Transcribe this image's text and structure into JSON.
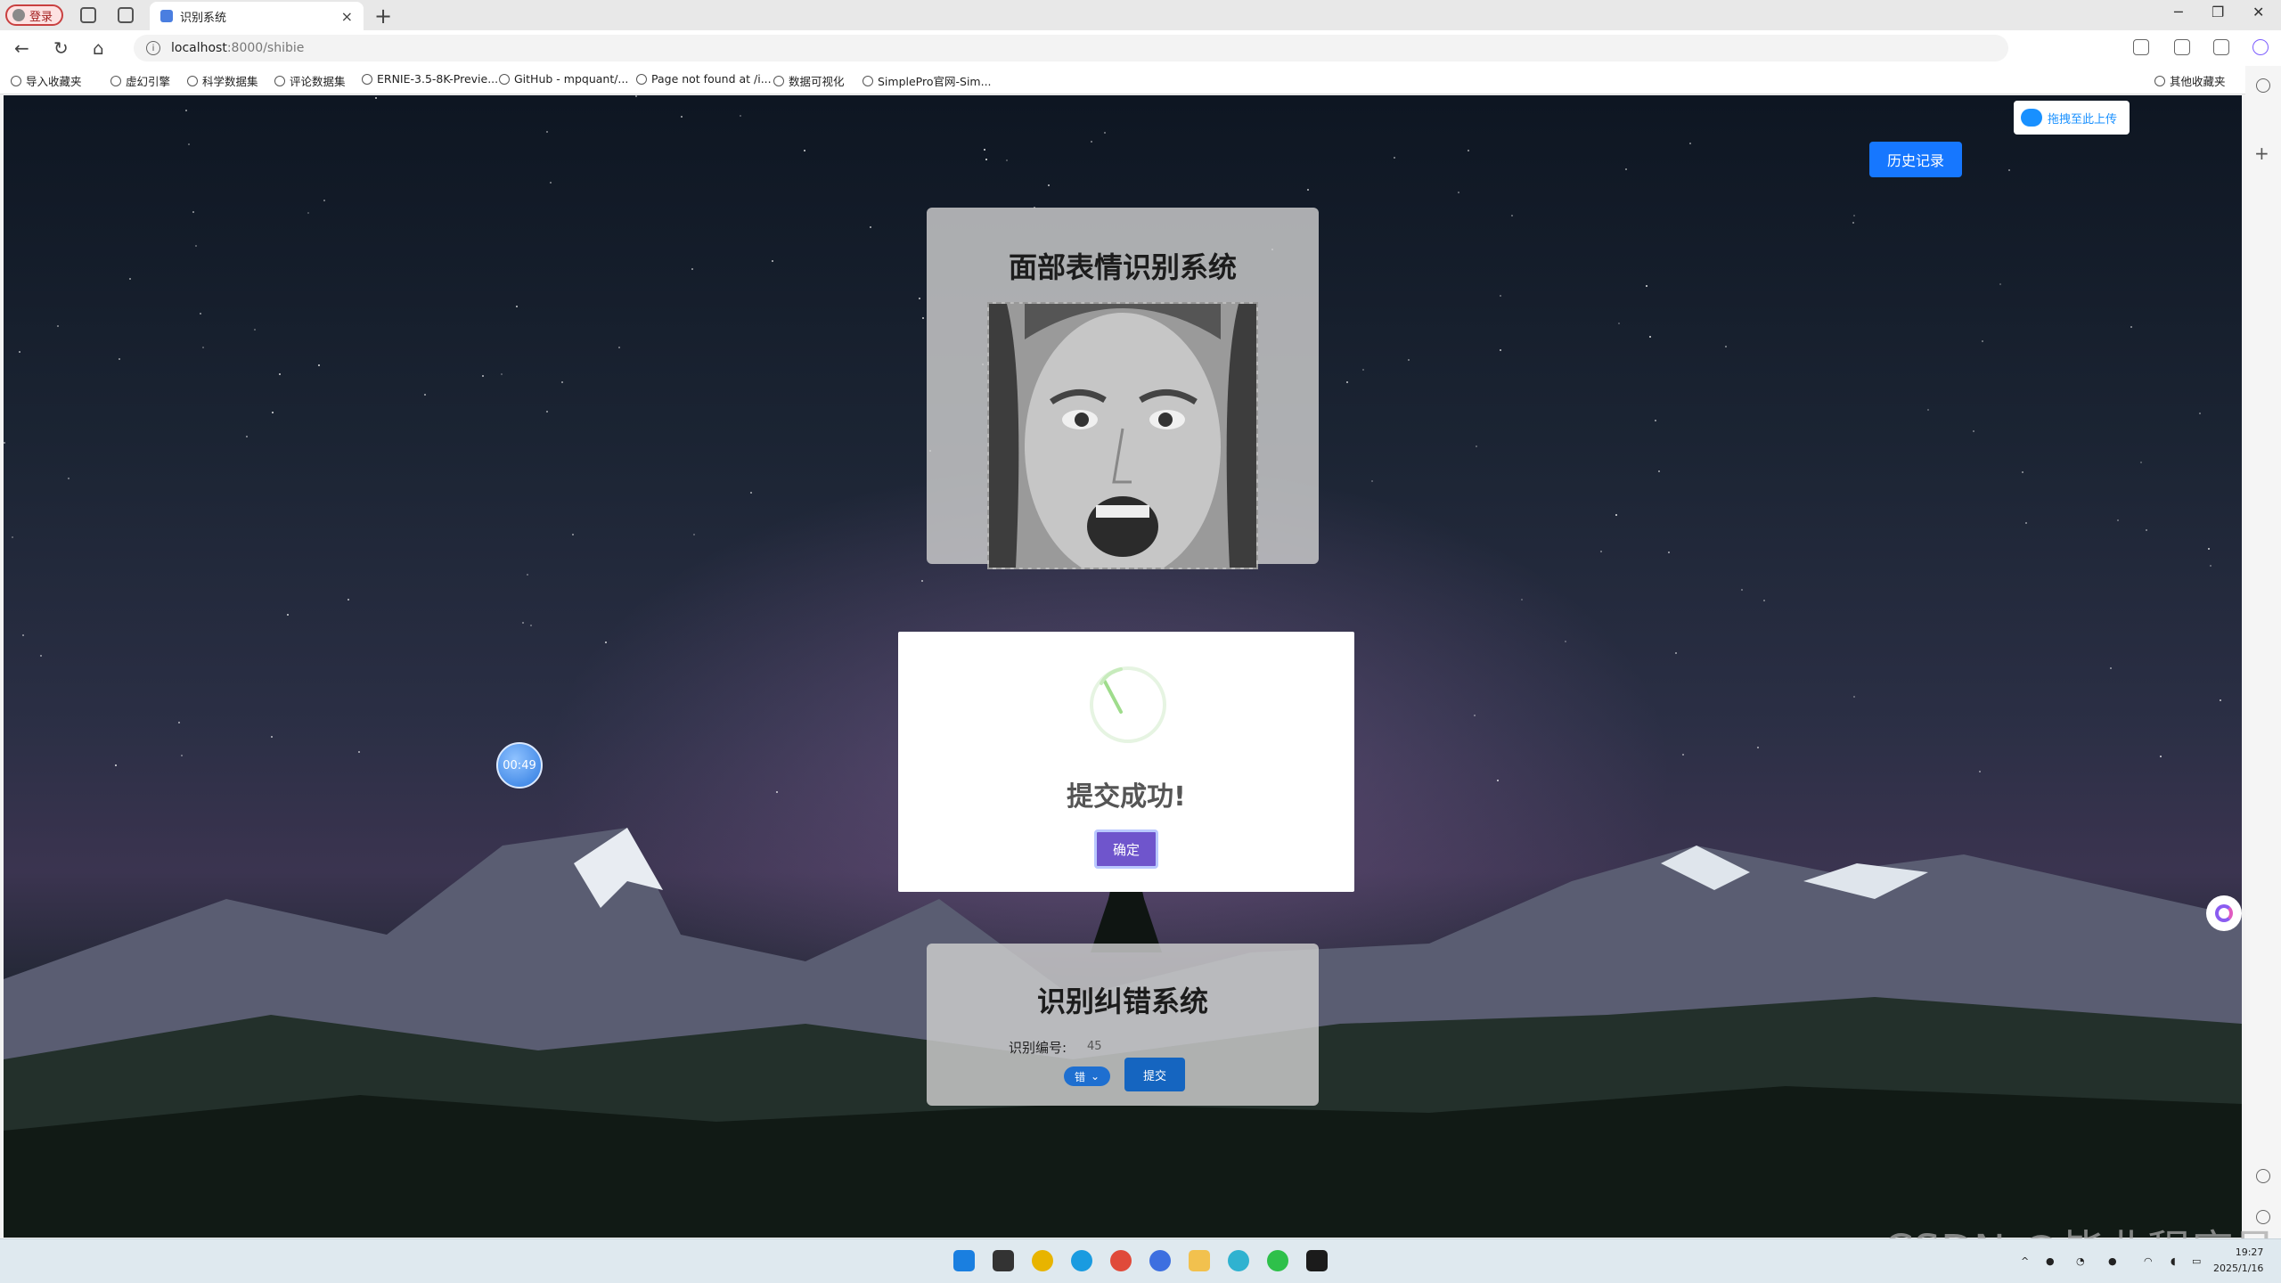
{
  "browser": {
    "profile_label": "登录",
    "tab_title": "识别系统",
    "url_host": "localhost",
    "url_path": ":8000/shibie",
    "bookmarks": [
      "导入收藏夹",
      "虚幻引擎",
      "科学数据集",
      "评论数据集",
      "ERNIE-3.5-8K-Previe...",
      "GitHub - mpquant/...",
      "Page not found at /i...",
      "数据可视化",
      "SimplePro官网-Sim..."
    ],
    "other_bookmarks": "其他收藏夹"
  },
  "page": {
    "upload_label": "拖拽至此上传",
    "history_button": "历史记录",
    "card_top_title": "面部表情识别系统",
    "card_bottom_title": "识别纠错系统",
    "id_label": "识别编号:",
    "id_value": "45",
    "select_value": "错",
    "submit_label": "提交",
    "timer": "00:49"
  },
  "modal": {
    "title": "提交成功!",
    "ok_label": "确定"
  },
  "taskbar": {
    "time": "19:27",
    "date": "2025/1/16"
  },
  "watermark": "CSDN @毕业程序员"
}
